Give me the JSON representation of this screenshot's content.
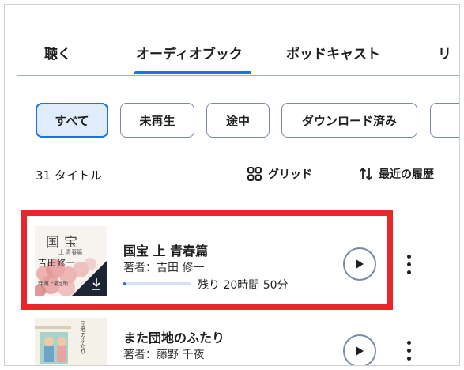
{
  "tabs": [
    {
      "label": "聴く"
    },
    {
      "label": "オーディオブック",
      "active": true
    },
    {
      "label": "ポッドキャスト"
    },
    {
      "label": "リ"
    }
  ],
  "filters": [
    {
      "label": "すべて",
      "selected": true
    },
    {
      "label": "未再生"
    },
    {
      "label": "途中"
    },
    {
      "label": "ダウンロード済み"
    }
  ],
  "library": {
    "count_label": "31 タイトル",
    "view_label": "グリッド",
    "sort_label": "最近の履歴"
  },
  "items": [
    {
      "title": "国宝 上 青春篇",
      "author": "著者：吉田 修一",
      "remaining": "残り 20時間 50分",
      "progress": 0.03,
      "cover": {
        "line1": "国宝",
        "line2": "上 青春篇",
        "author": "吉田修一",
        "extra": "詩 尾上菊之助",
        "downloaded": true
      }
    },
    {
      "title": "また団地のふたり",
      "author": "著者：藤野 千夜",
      "cover": {
        "line1": "団地のふたり"
      }
    }
  ],
  "colors": {
    "accent": "#1a73e8",
    "highlight": "#e8262b"
  }
}
